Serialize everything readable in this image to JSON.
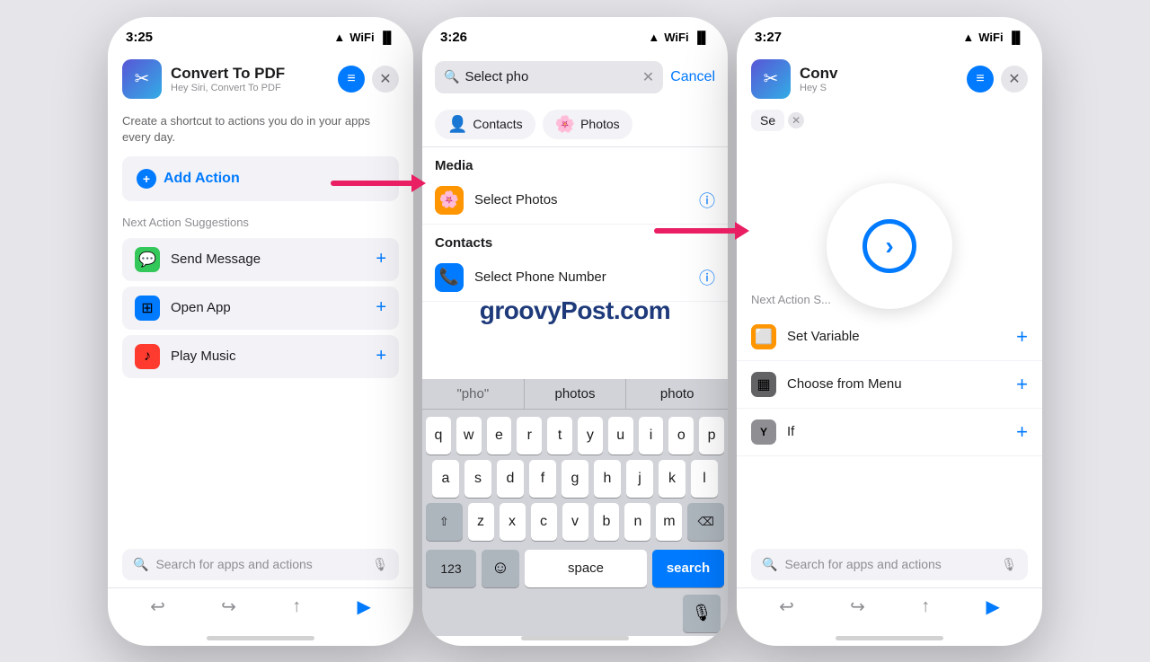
{
  "phone1": {
    "status_time": "3:25",
    "app_title": "Convert To PDF",
    "app_subtitle": "Hey Siri, Convert To PDF",
    "description": "Create a shortcut to actions you do in your apps every day.",
    "add_action_label": "Add Action",
    "suggestions_title": "Next Action Suggestions",
    "suggestions": [
      {
        "id": "send-message",
        "label": "Send Message",
        "icon": "💬",
        "bg": "#34c759"
      },
      {
        "id": "open-app",
        "label": "Open App",
        "icon": "⊞",
        "bg": "#007aff"
      },
      {
        "id": "play-music",
        "label": "Play Music",
        "icon": "🎵",
        "bg": "#ff3b30"
      }
    ],
    "search_placeholder": "Search for apps and actions",
    "toolbar": {
      "back": "↩",
      "forward": "↪",
      "share": "↑",
      "play": "▶"
    }
  },
  "phone2": {
    "status_time": "3:26",
    "search_value": "Select pho",
    "cancel_label": "Cancel",
    "chips": [
      {
        "label": "Contacts",
        "icon": "👤"
      },
      {
        "label": "Photos",
        "icon": "🌸"
      }
    ],
    "media_section": "Media",
    "media_items": [
      {
        "id": "select-photos",
        "label": "Select Photos",
        "icon": "🌸",
        "bg": "#ff9500"
      }
    ],
    "contacts_section": "Contacts",
    "contacts_items": [
      {
        "id": "select-phone",
        "label": "Select Phone Number",
        "icon": "📞",
        "bg": "#007aff"
      }
    ],
    "word_suggestions": [
      {
        "text": "\"pho\"",
        "quoted": true
      },
      {
        "text": "photos",
        "quoted": false
      },
      {
        "text": "photo",
        "quoted": false
      }
    ],
    "keyboard_rows": [
      [
        "q",
        "w",
        "e",
        "r",
        "t",
        "y",
        "u",
        "i",
        "o",
        "p"
      ],
      [
        "a",
        "s",
        "d",
        "f",
        "g",
        "h",
        "j",
        "k",
        "l"
      ],
      [
        "z",
        "x",
        "c",
        "v",
        "b",
        "n",
        "m"
      ]
    ],
    "num_key": "123",
    "space_label": "space",
    "search_label": "search"
  },
  "phone3": {
    "status_time": "3:27",
    "app_title": "Conv",
    "app_subtitle": "Hey S",
    "se_badge": "Se",
    "next_label": "Next Action S...",
    "next_items": [
      {
        "id": "set-variable",
        "label": "Set Variable",
        "icon": "🟠",
        "bg": "#ff9500"
      },
      {
        "id": "choose-menu",
        "label": "Choose from Menu",
        "icon": "▦",
        "bg": "#636366"
      },
      {
        "id": "if",
        "label": "If",
        "icon": "Y",
        "bg": "#8e8e93"
      }
    ],
    "search_placeholder": "Search for apps and actions"
  },
  "watermark": "groovyPost.com",
  "icons": {
    "shortcuts": "✂️",
    "menu": "≡",
    "close": "✕",
    "plus": "+",
    "info": "ⓘ",
    "search": "🔍",
    "mic": "🎙️",
    "shift": "⇧",
    "backspace": "⌫",
    "emoji": "☺",
    "chevron_right": "›"
  }
}
